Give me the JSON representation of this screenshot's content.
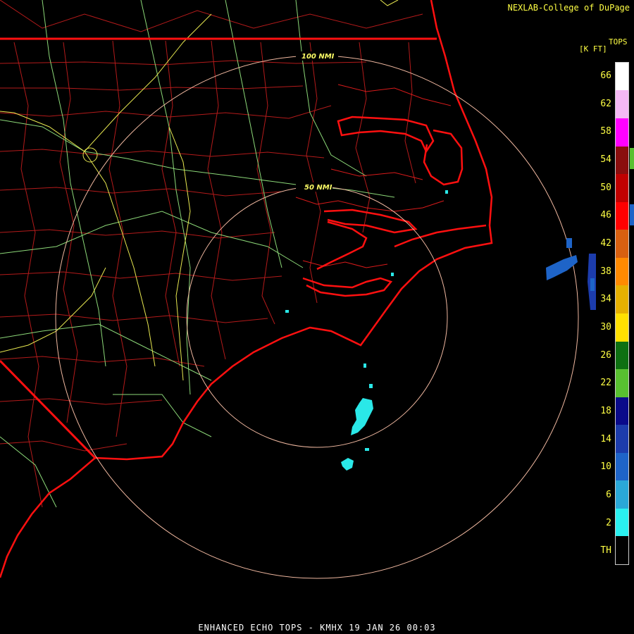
{
  "header": {
    "credit": "NEXLAB-College of DuPage"
  },
  "legend": {
    "title": "TOPS",
    "unit": "[K FT]",
    "ticks": [
      "TH",
      "2",
      "6",
      "10",
      "14",
      "18",
      "22",
      "26",
      "30",
      "34",
      "38",
      "42",
      "46",
      "50",
      "54",
      "58",
      "62",
      "66"
    ],
    "colors": [
      "#000000",
      "#2af0f0",
      "#2aa8d8",
      "#1e64c8",
      "#1c3cac",
      "#0a0a8a",
      "#58c030",
      "#0e7012",
      "#ffe000",
      "#e6b000",
      "#ff8a00",
      "#d86010",
      "#ff0000",
      "#c00000",
      "#8a0e0e",
      "#ff00ff",
      "#f4b8f4",
      "#ffffff"
    ]
  },
  "map": {
    "rings": [
      {
        "label": "50 NMI"
      },
      {
        "label": "100 NMI"
      }
    ],
    "radar_site": "KMHX"
  },
  "caption": "ENHANCED ECHO TOPS - KMHX 19 JAN 26 00:03"
}
